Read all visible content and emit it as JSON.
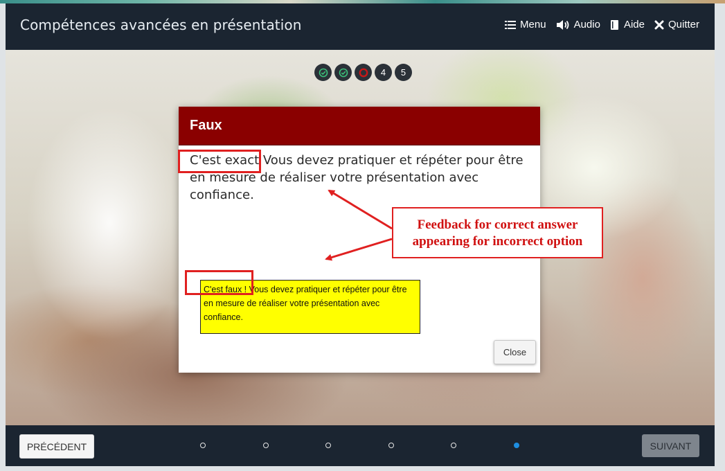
{
  "header": {
    "title": "Compétences avancées en présentation",
    "menu": [
      {
        "label": "Menu",
        "icon": "list-icon"
      },
      {
        "label": "Audio",
        "icon": "speaker-icon"
      },
      {
        "label": "Aide",
        "icon": "book-icon"
      },
      {
        "label": "Quitter",
        "icon": "close-icon"
      }
    ]
  },
  "progress": [
    {
      "state": "correct",
      "label": ""
    },
    {
      "state": "correct",
      "label": ""
    },
    {
      "state": "incorrect",
      "label": ""
    },
    {
      "state": "pending",
      "label": "4"
    },
    {
      "state": "pending",
      "label": "5"
    }
  ],
  "dialog": {
    "title": "Faux",
    "feedback_highlight": "C'est exact",
    "feedback_rest": " Vous devez pratiquer et répéter pour être en mesure de réaliser votre présentation avec confiance.",
    "note_text": "C'est faux ! Vous devez pratiquer et répéter pour être en mesure de réaliser votre présentation avec confiance.",
    "close_label": "Close"
  },
  "annotation": {
    "line1": "Feedback for correct answer",
    "line2": "appearing for incorrect option"
  },
  "footer": {
    "prev_label": "PRÉCÉDENT",
    "next_label": "SUIVANT",
    "slide_count": 6,
    "active_slide": 6
  },
  "colors": {
    "bar": "#1b2531",
    "dialog_header": "#8a0000",
    "note_background": "#ffff00",
    "annotation_red": "#e02020",
    "check_green": "#3bbf7a",
    "incorrect_red": "#c81818",
    "active_dot": "#1e8ee0"
  }
}
